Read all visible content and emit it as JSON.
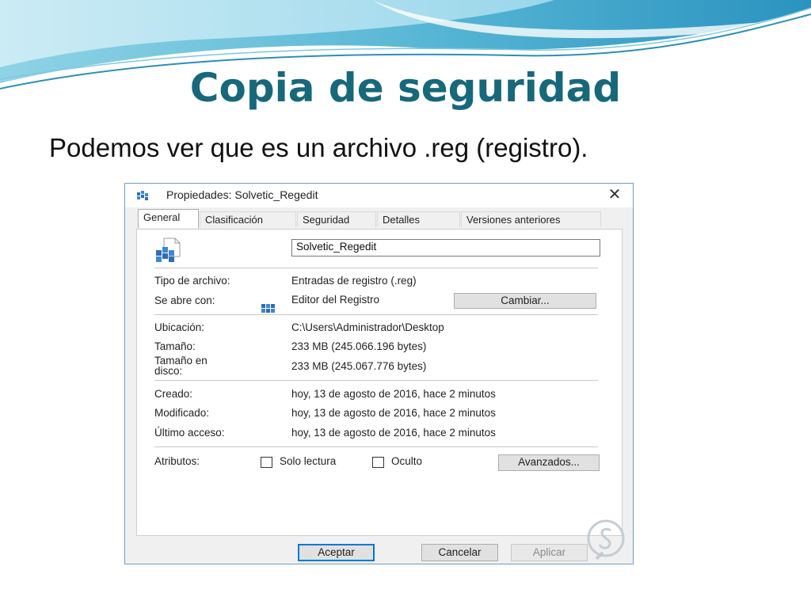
{
  "slide": {
    "title": "Copia de seguridad",
    "subtitle": "Podemos ver que es un archivo .reg (registro)."
  },
  "dialog": {
    "title": "Propiedades: Solvetic_Regedit",
    "close_icon": "close-icon",
    "tabs": [
      {
        "label": "General",
        "active": true
      },
      {
        "label": "Clasificación",
        "active": false
      },
      {
        "label": "Seguridad",
        "active": false
      },
      {
        "label": "Detalles",
        "active": false
      },
      {
        "label": "Versiones anteriores",
        "active": false
      }
    ],
    "file_name": "Solvetic_Regedit",
    "file_type_label": "Tipo de archivo:",
    "file_type_value": "Entradas de registro (.reg)",
    "opens_with_label": "Se abre con:",
    "opens_with_value": "Editor del Registro",
    "change_button": "Cambiar...",
    "location_label": "Ubicación:",
    "location_value": "C:\\Users\\Administrador\\Desktop",
    "size_label": "Tamaño:",
    "size_value": "233 MB (245.066.196 bytes)",
    "size_on_disk_label_1": "Tamaño en",
    "size_on_disk_label_2": "disco:",
    "size_on_disk_value": "233 MB (245.067.776 bytes)",
    "created_label": "Creado:",
    "created_value": "hoy, 13 de agosto de 2016, hace 2 minutos",
    "modified_label": "Modificado:",
    "modified_value": "hoy, 13 de agosto de 2016, hace 2 minutos",
    "accessed_label": "Último acceso:",
    "accessed_value": "hoy, 13 de agosto de 2016, hace 2 minutos",
    "attributes_label": "Atributos:",
    "readonly_label": "Solo lectura",
    "readonly_checked": false,
    "hidden_label": "Oculto",
    "hidden_checked": false,
    "advanced_button": "Avanzados...",
    "ok_button": "Aceptar",
    "cancel_button": "Cancelar",
    "apply_button": "Aplicar"
  },
  "colors": {
    "title": "#17687a",
    "accent_wave": "#3aa6c8",
    "default_button_border": "#0078d7"
  }
}
